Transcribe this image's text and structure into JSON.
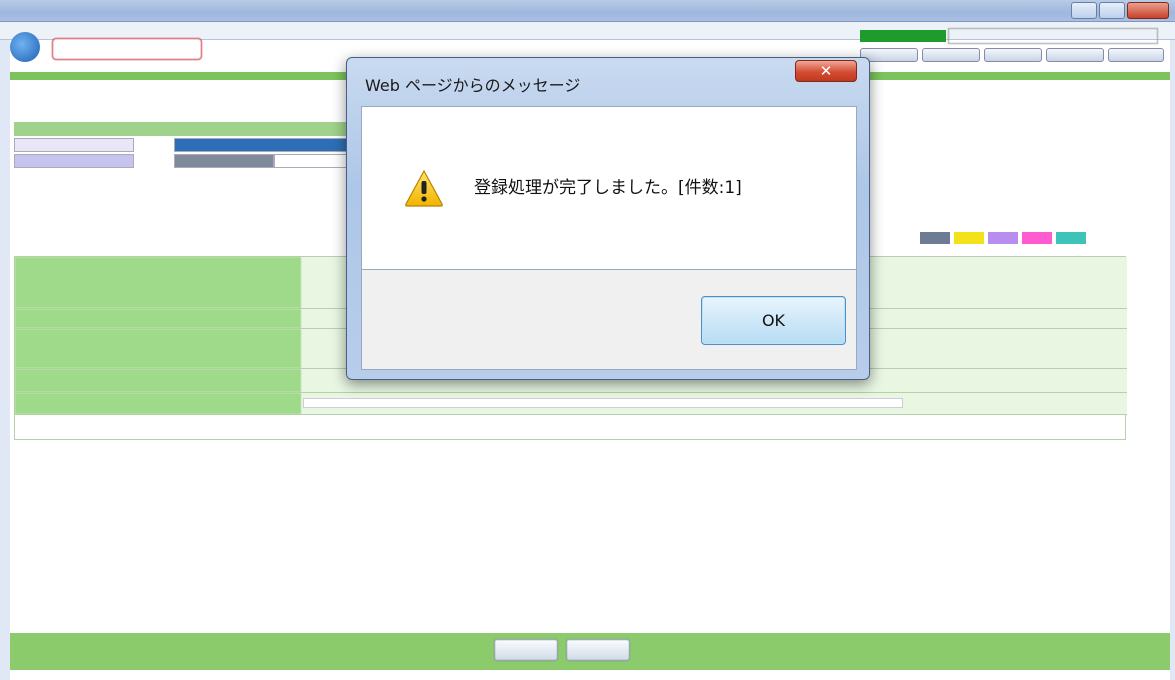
{
  "dialog": {
    "title": "Web ページからのメッセージ",
    "close_glyph": "✕",
    "message": "登録処理が完了しました。[件数:1]",
    "icon": "warning-icon",
    "ok_label": "OK"
  },
  "colors": {
    "accent_green": "#8bcb6c",
    "label_green": "#9fd98a",
    "dialog_frame": "#aec6e7",
    "close_red": "#c9412a"
  }
}
